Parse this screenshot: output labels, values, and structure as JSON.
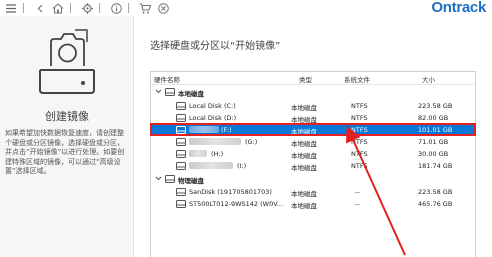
{
  "toolbar": {
    "icons": [
      "menu-icon",
      "back-icon",
      "home-icon",
      "settings-icon",
      "info-icon",
      "cart-icon",
      "help-icon"
    ],
    "brand": "Ontrack"
  },
  "left_panel": {
    "title": "创建镜像",
    "description": "如果希望加快数据恢复速度，请创建整个硬盘或分区镜像，选择硬盘或分区，并点击“开始镜像”以进行处理。如要创建特殊区域的镜像，可以通过“高级设置”选择区域。"
  },
  "main": {
    "prompt": "选择硬盘或分区以“开始镜像”",
    "columns": [
      "硬件名称",
      "类型",
      "系统文件",
      "大小"
    ],
    "groups": [
      {
        "label": "本地磁盘",
        "rows": [
          {
            "name": "Local Disk (C:)",
            "type": "本地磁盘",
            "fs": "NTFS",
            "size": "223.58 GB"
          },
          {
            "name": "Local Disk (D:)",
            "type": "本地磁盘",
            "fs": "NTFS",
            "size": "82.00 GB"
          },
          {
            "name": "(F:)",
            "type": "本地磁盘",
            "fs": "NTFS",
            "size": "101.01 GB"
          },
          {
            "name": "(G:)",
            "type": "本地磁盘",
            "fs": "NTFS",
            "size": "71.01 GB"
          },
          {
            "name": "(H:)",
            "type": "本地磁盘",
            "fs": "NTFS",
            "size": "30.00 GB"
          },
          {
            "name": "(I:)",
            "type": "本地磁盘",
            "fs": "NTFS",
            "size": "181.74 GB"
          }
        ]
      },
      {
        "label": "物理磁盘",
        "rows": [
          {
            "name": "SanDisk (191705801703)",
            "type": "本地磁盘",
            "fs": "--",
            "size": "223.58 GB"
          },
          {
            "name": "ST500LT012-9WS142 (W0V...",
            "type": "本地磁盘",
            "fs": "--",
            "size": "465.76 GB"
          }
        ]
      }
    ]
  },
  "colors": {
    "brand": "#1f6fc4",
    "selection": "#0a78d7",
    "annotation": "#e52020"
  }
}
